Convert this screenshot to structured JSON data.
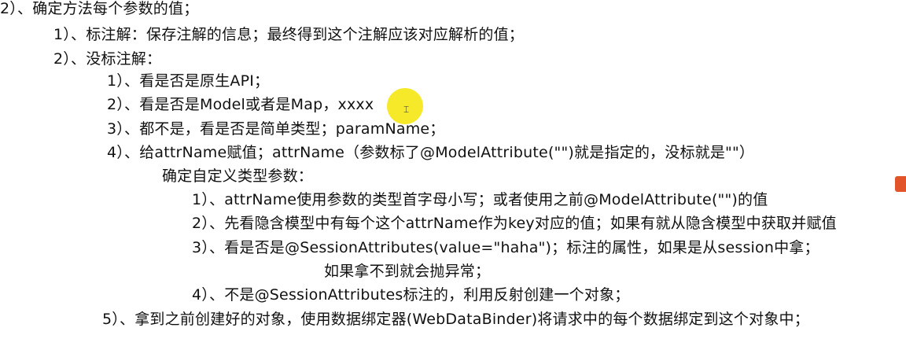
{
  "lines": {
    "l1": "2）、确定方法每个参数的值；",
    "l2": "1）、标注解：保存注解的信息；最终得到这个注解应该对应解析的值；",
    "l3": "2）、没标注解：",
    "l4": "1）、看是否是原生API；",
    "l5": "2）、看是否是Model或者是Map，xxxx",
    "l6": "3）、都不是，看是否是简单类型；paramName；",
    "l7": "4）、给attrName赋值；attrName（参数标了@ModelAttribute(\"\")就是指定的，没标就是\"\"）",
    "l8": "确定自定义类型参数：",
    "l9": "1）、attrName使用参数的类型首字母小写；或者使用之前@ModelAttribute(\"\")的值",
    "l10": "2）、先看隐含模型中有每个这个attrName作为key对应的值；如果有就从隐含模型中获取并赋值",
    "l11": "3）、看是否是@SessionAttributes(value=\"haha\")；标注的属性，如果是从session中拿；",
    "l12": "如果拿不到就会抛异常；",
    "l13": "4）、不是@SessionAttributes标注的，利用反射创建一个对象；",
    "l14": "5）、拿到之前创建好的对象，使用数据绑定器(WebDataBinder)将请求中的每个数据绑定到这个对象中；"
  },
  "colors": {
    "highlight": "#f5e712",
    "edge_icon": "#e2542a"
  }
}
